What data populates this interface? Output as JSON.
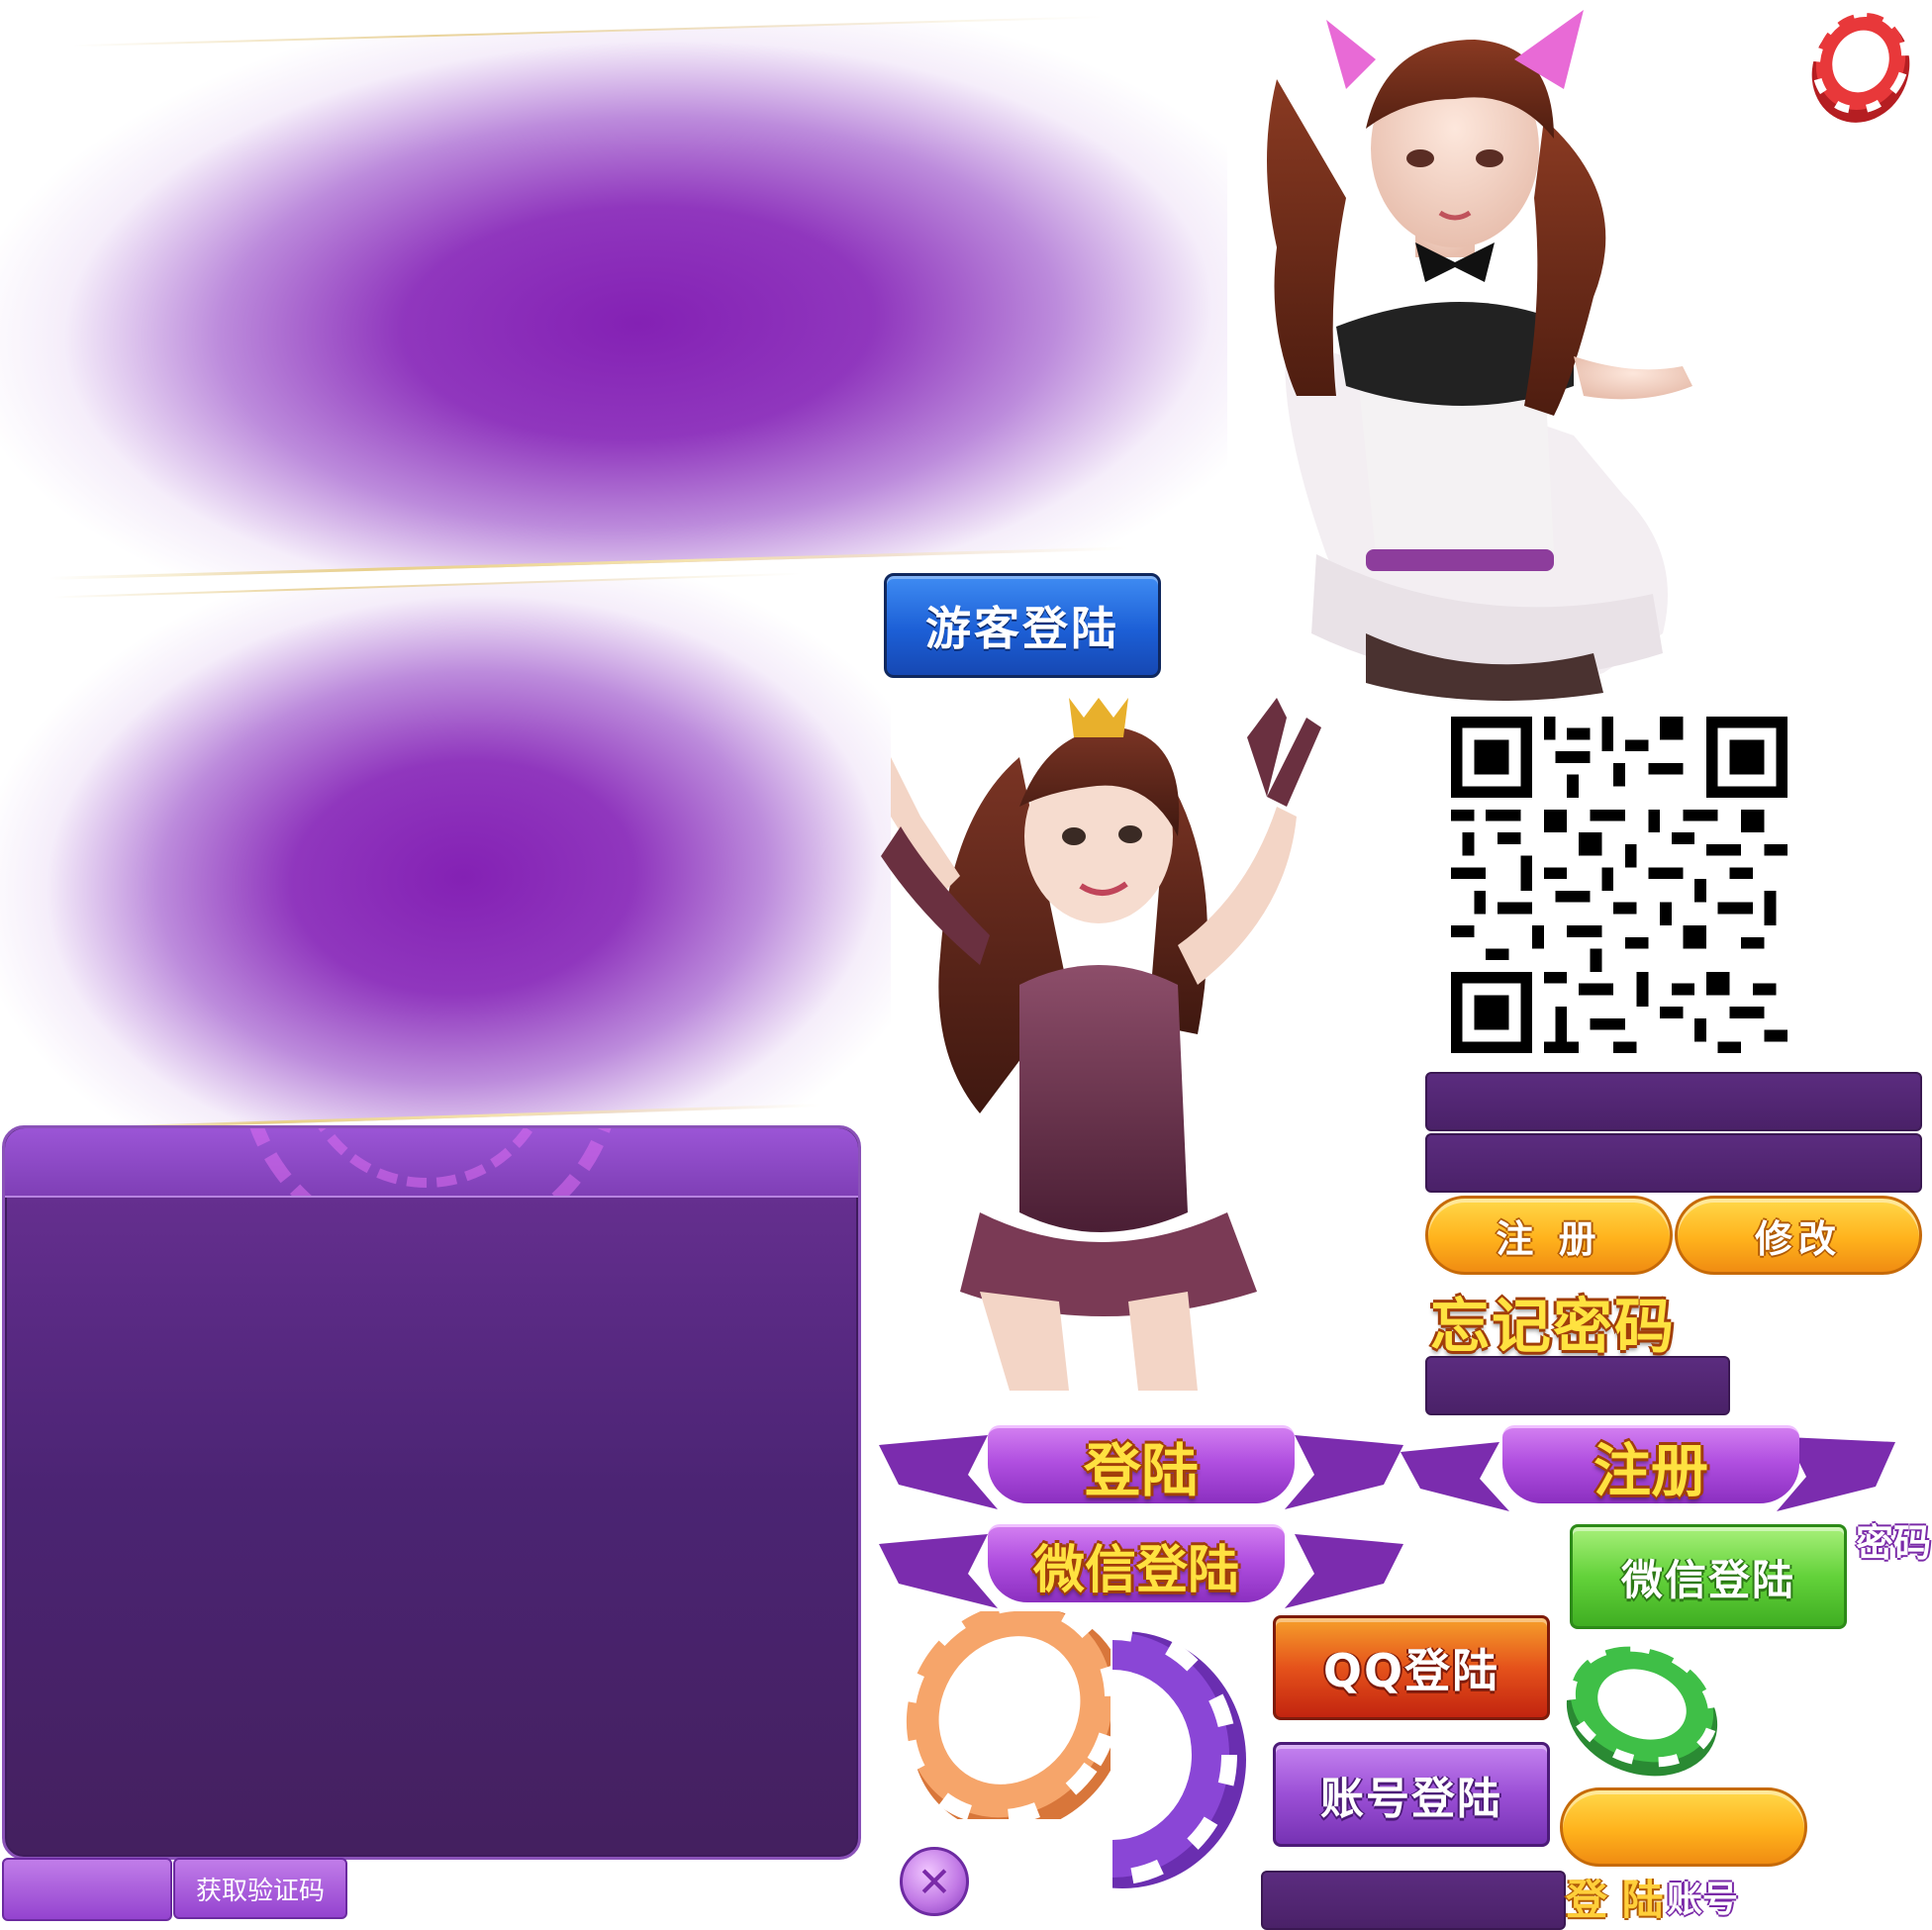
{
  "buttons": {
    "guest_login": "游客登陆",
    "register_pill": "注 册",
    "modify_pill": "修改",
    "wechat_login": "微信登陆",
    "qq_login": "QQ登陆",
    "account_login": "账号登陆",
    "get_code": "获取验证码",
    "close_symbol": "✕"
  },
  "titles": {
    "forgot_password": "忘记密码",
    "password_label": "密码",
    "login_ribbon": "登陆",
    "register_ribbon": "注册",
    "wechat_ribbon": "微信登陆"
  },
  "bottom_labels": {
    "login_text": "登 陆",
    "account_text": "账号"
  },
  "icons": {
    "chips": [
      "red-chip-icon",
      "orange-chip-icon",
      "purple-chip-icon",
      "green-chip-icon"
    ],
    "qr": "qr-code-icon",
    "characters": [
      "girl-character-cat-ears",
      "girl-character-crown"
    ]
  },
  "colors": {
    "panel_purple": "#4b2473",
    "accent_purple": "#9b55d6",
    "guest_blue": "#1c5fd6",
    "orange": "#ffb21c",
    "green": "#63d23a",
    "red": "#e5521b",
    "title_yellow": "#ffe240"
  }
}
